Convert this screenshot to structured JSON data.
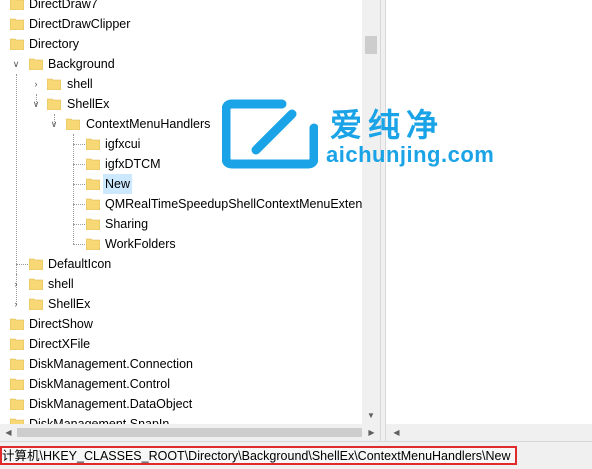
{
  "tree": {
    "items": [
      {
        "label": "DirectDraw7",
        "icon": "folder-icon",
        "expander": "none"
      },
      {
        "label": "DirectDrawClipper",
        "icon": "folder-icon",
        "expander": "none"
      },
      {
        "label": "Directory",
        "icon": "folder-icon",
        "expander": "none"
      },
      {
        "label": "Background",
        "icon": "folder-icon",
        "expander": "expanded"
      },
      {
        "label": "shell",
        "icon": "folder-icon",
        "expander": "collapsed"
      },
      {
        "label": "ShellEx",
        "icon": "folder-icon",
        "expander": "expanded"
      },
      {
        "label": "ContextMenuHandlers",
        "icon": "folder-icon",
        "expander": "expanded"
      },
      {
        "label": "igfxcui",
        "icon": "folder-icon",
        "expander": "none"
      },
      {
        "label": "igfxDTCM",
        "icon": "folder-icon",
        "expander": "none"
      },
      {
        "label": "New",
        "icon": "folder-icon",
        "expander": "none",
        "selected": true
      },
      {
        "label": "QMRealTimeSpeedupShellContextMenuExtension",
        "icon": "folder-icon",
        "expander": "none"
      },
      {
        "label": "Sharing",
        "icon": "folder-icon",
        "expander": "none"
      },
      {
        "label": "WorkFolders",
        "icon": "folder-icon",
        "expander": "none"
      },
      {
        "label": "DefaultIcon",
        "icon": "folder-icon",
        "expander": "none"
      },
      {
        "label": "shell",
        "icon": "folder-icon",
        "expander": "collapsed"
      },
      {
        "label": "ShellEx",
        "icon": "folder-icon",
        "expander": "collapsed"
      },
      {
        "label": "DirectShow",
        "icon": "folder-icon",
        "expander": "none"
      },
      {
        "label": "DirectXFile",
        "icon": "folder-icon",
        "expander": "none"
      },
      {
        "label": "DiskManagement.Connection",
        "icon": "folder-icon",
        "expander": "none"
      },
      {
        "label": "DiskManagement.Control",
        "icon": "folder-icon",
        "expander": "none"
      },
      {
        "label": "DiskManagement.DataObject",
        "icon": "folder-icon",
        "expander": "none"
      },
      {
        "label": "DiskManagement.SnapIn",
        "icon": "folder-icon",
        "expander": "none"
      }
    ]
  },
  "status": {
    "path": "计算机\\HKEY_CLASSES_ROOT\\Directory\\Background\\ShellEx\\ContextMenuHandlers\\New"
  },
  "watermark": {
    "chinese": "爱纯净",
    "domain": "aichunjing.com"
  },
  "colors": {
    "folder": "#f8d775",
    "selection": "#cce8ff",
    "highlight_border": "#e02b2b",
    "watermark": "#1aa3e6"
  }
}
